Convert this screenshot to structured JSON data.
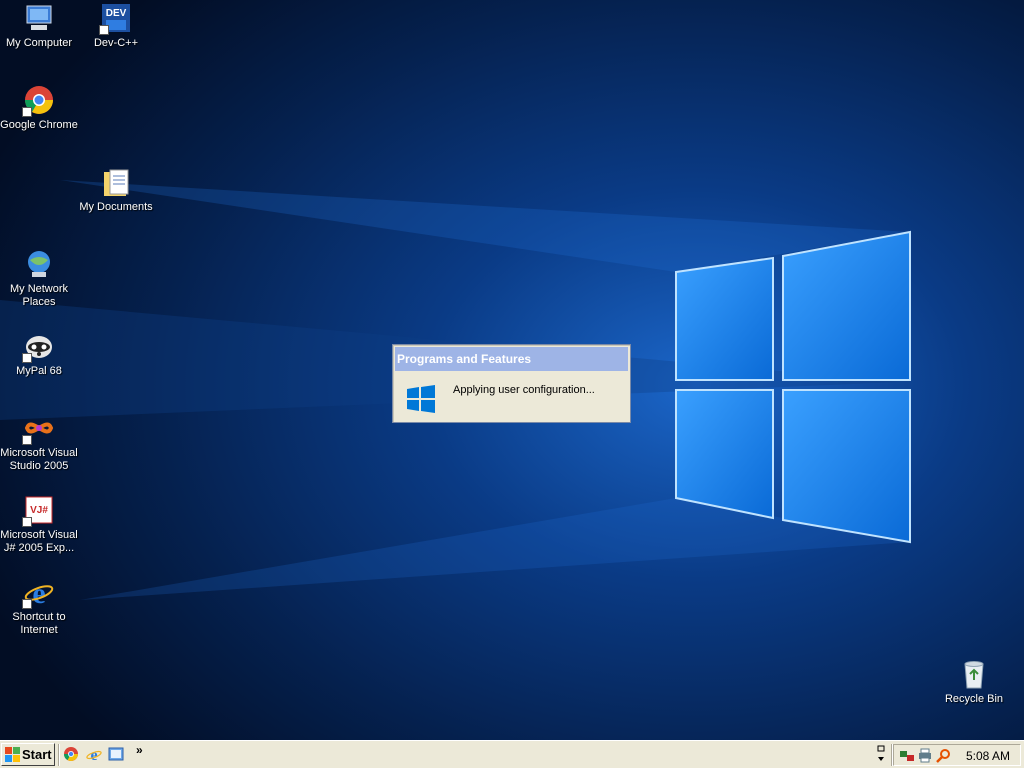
{
  "desktop": {
    "icons": [
      {
        "label": "My Computer",
        "icon": "my-computer-icon"
      },
      {
        "label": "Dev-C++",
        "icon": "devcpp-icon",
        "badge": "DEV"
      },
      {
        "label": "Google Chrome",
        "icon": "chrome-icon"
      },
      {
        "label": "My Documents",
        "icon": "my-documents-icon"
      },
      {
        "label": "My Network Places",
        "icon": "network-places-icon"
      },
      {
        "label": "MyPal 68",
        "icon": "mypal-icon"
      },
      {
        "label": "Microsoft Visual Studio 2005",
        "icon": "visual-studio-icon"
      },
      {
        "label": "Microsoft Visual J# 2005 Exp...",
        "icon": "visual-jsharp-icon",
        "badge": "VJ#"
      },
      {
        "label": "Shortcut to Internet",
        "icon": "internet-explorer-icon"
      },
      {
        "label": "Recycle Bin",
        "icon": "recycle-bin-icon"
      }
    ]
  },
  "dialog": {
    "title": "Programs and Features",
    "message": "Applying user configuration...",
    "icon": "windows-logo-icon"
  },
  "taskbar": {
    "start_label": "Start",
    "chevron": "»",
    "clock": "5:08 AM",
    "quick_launch": [
      "chrome-icon",
      "internet-explorer-icon",
      "outlook-express-icon"
    ],
    "tray_icons": [
      "network-icon",
      "printer-icon",
      "search-icon"
    ]
  },
  "colors": {
    "taskbar": "#ece9d8",
    "dialog_title": "#9eb4e6",
    "windows_blue": "#0078d7"
  }
}
